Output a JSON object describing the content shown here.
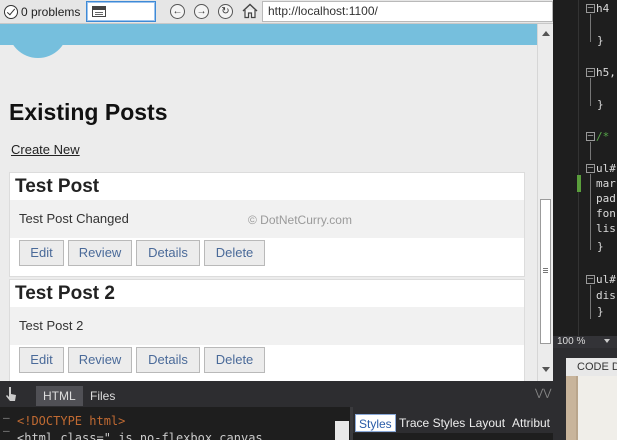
{
  "toolbar": {
    "problems_label": "0 problems",
    "url": "http://localhost:1100/"
  },
  "page": {
    "title": "Existing Posts",
    "create_link": "Create New",
    "watermark": "© DotNetCurry.com",
    "posts": [
      {
        "title": "Test Post",
        "body": "Test Post Changed",
        "actions": [
          "Edit",
          "Review",
          "Details",
          "Delete"
        ]
      },
      {
        "title": "Test Post 2",
        "body": "Test Post 2",
        "actions": [
          "Edit",
          "Review",
          "Details",
          "Delete"
        ]
      }
    ]
  },
  "editor": {
    "lines": [
      "h4",
      "}",
      "h5,",
      "}",
      "/*",
      "ul#",
      "mar",
      "pad",
      "fon",
      "lis",
      "}",
      "ul#",
      "dis",
      "}"
    ],
    "zoom": "100 %"
  },
  "code_definition": {
    "title": "CODE D"
  },
  "devtools": {
    "tabs": [
      "HTML",
      "Files"
    ],
    "code_lines": [
      "<!DOCTYPE html>",
      "<html class=\" js no-flexbox canvas"
    ],
    "style_tabs": [
      "Styles",
      "Trace Styles",
      "Layout",
      "Attribut"
    ]
  },
  "colors": {
    "header_band": "#76bfdd",
    "button_text": "#4a6a99",
    "editor_bg": "#1e1e1e"
  }
}
